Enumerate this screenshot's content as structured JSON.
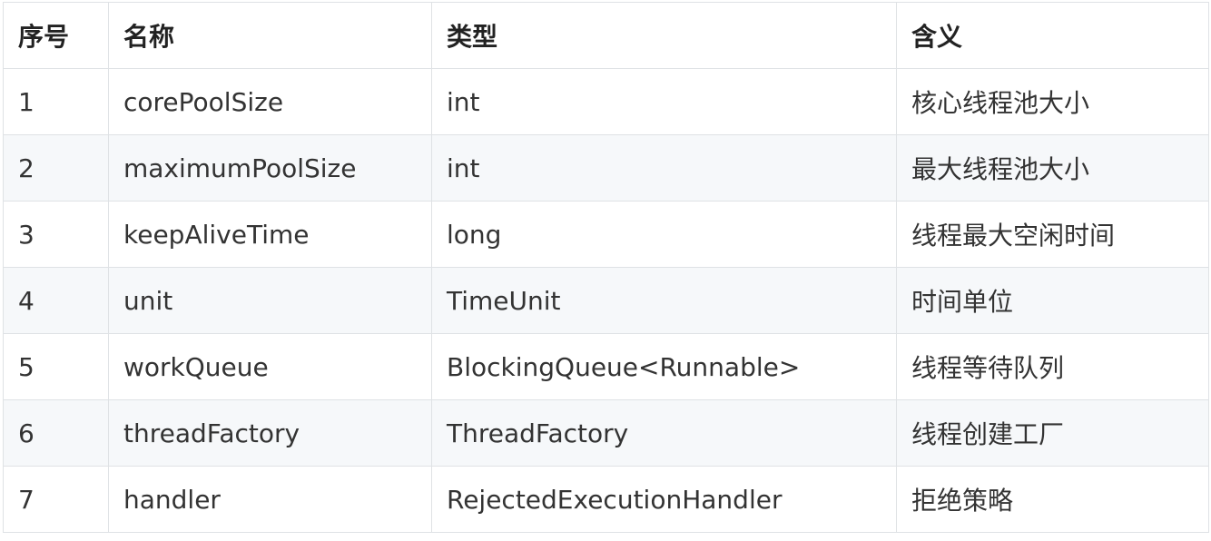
{
  "table": {
    "headers": [
      "序号",
      "名称",
      "类型",
      "含义"
    ],
    "rows": [
      [
        "1",
        "corePoolSize",
        "int",
        "核心线程池大小"
      ],
      [
        "2",
        "maximumPoolSize",
        "int",
        "最大线程池大小"
      ],
      [
        "3",
        "keepAliveTime",
        "long",
        "线程最大空闲时间"
      ],
      [
        "4",
        "unit",
        "TimeUnit",
        "时间单位"
      ],
      [
        "5",
        "workQueue",
        "BlockingQueue<Runnable>",
        "线程等待队列"
      ],
      [
        "6",
        "threadFactory",
        "ThreadFactory",
        "线程创建工厂"
      ],
      [
        "7",
        "handler",
        "RejectedExecutionHandler",
        "拒绝策略"
      ]
    ]
  },
  "colors": {
    "border": "#dfe2e5",
    "stripe": "#f6f8fa",
    "text": "#333333"
  }
}
